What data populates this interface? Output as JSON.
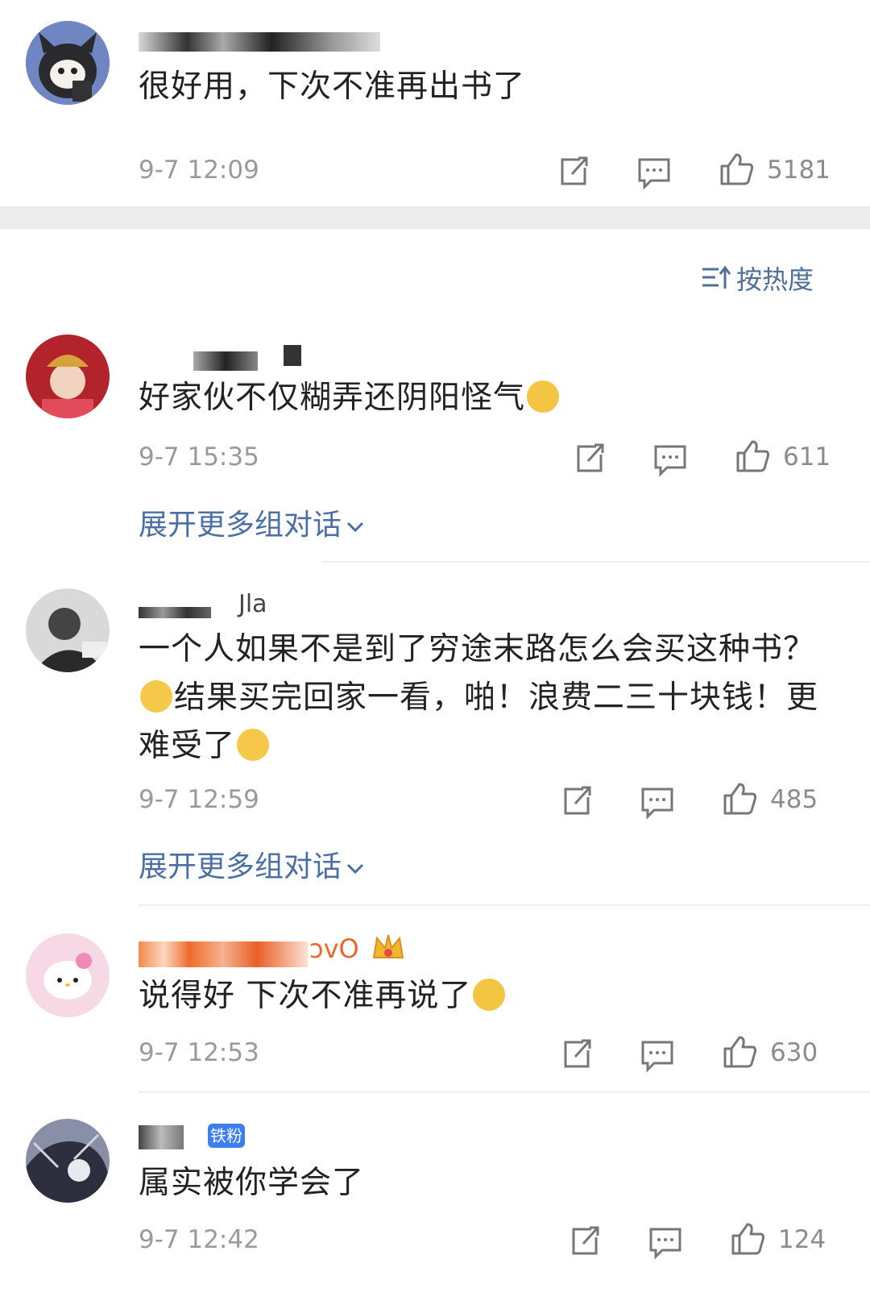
{
  "top_comment": {
    "text": "很好用，下次不准再出书了",
    "time": "9-7 12:09",
    "likes": "5181"
  },
  "sort": {
    "label": "按热度"
  },
  "comments": [
    {
      "text": "好家伙不仅糊弄还阴阳怪气",
      "time": "9-7 15:35",
      "likes": "611",
      "expand": "展开更多组对话"
    },
    {
      "name_fragment": "Jla",
      "text_line1": "一个人如果不是到了穷途末路怎么会买这种书？",
      "text_line2": "结果买完回家一看，啪！浪费二三十块钱！更",
      "text_line3": "难受了",
      "time": "9-7 12:59",
      "likes": "485",
      "expand": "展开更多组对话"
    },
    {
      "name_fragment": "ɔvO",
      "text": "说得好 下次不准再说了",
      "time": "9-7 12:53",
      "likes": "630"
    },
    {
      "badge": "铁粉",
      "text": "属实被你学会了",
      "time": "9-7 12:42",
      "likes": "124"
    }
  ],
  "icons": [
    "share-icon",
    "comment-icon",
    "like-icon",
    "sort-icon",
    "chevron-down-icon",
    "doge-emoji-icon",
    "cry-emoji-icon",
    "crown-icon"
  ],
  "colors": {
    "link": "#4a6fa5",
    "meta": "#9a9a9a",
    "divider": "#eeeeee",
    "band": "#ececec"
  }
}
